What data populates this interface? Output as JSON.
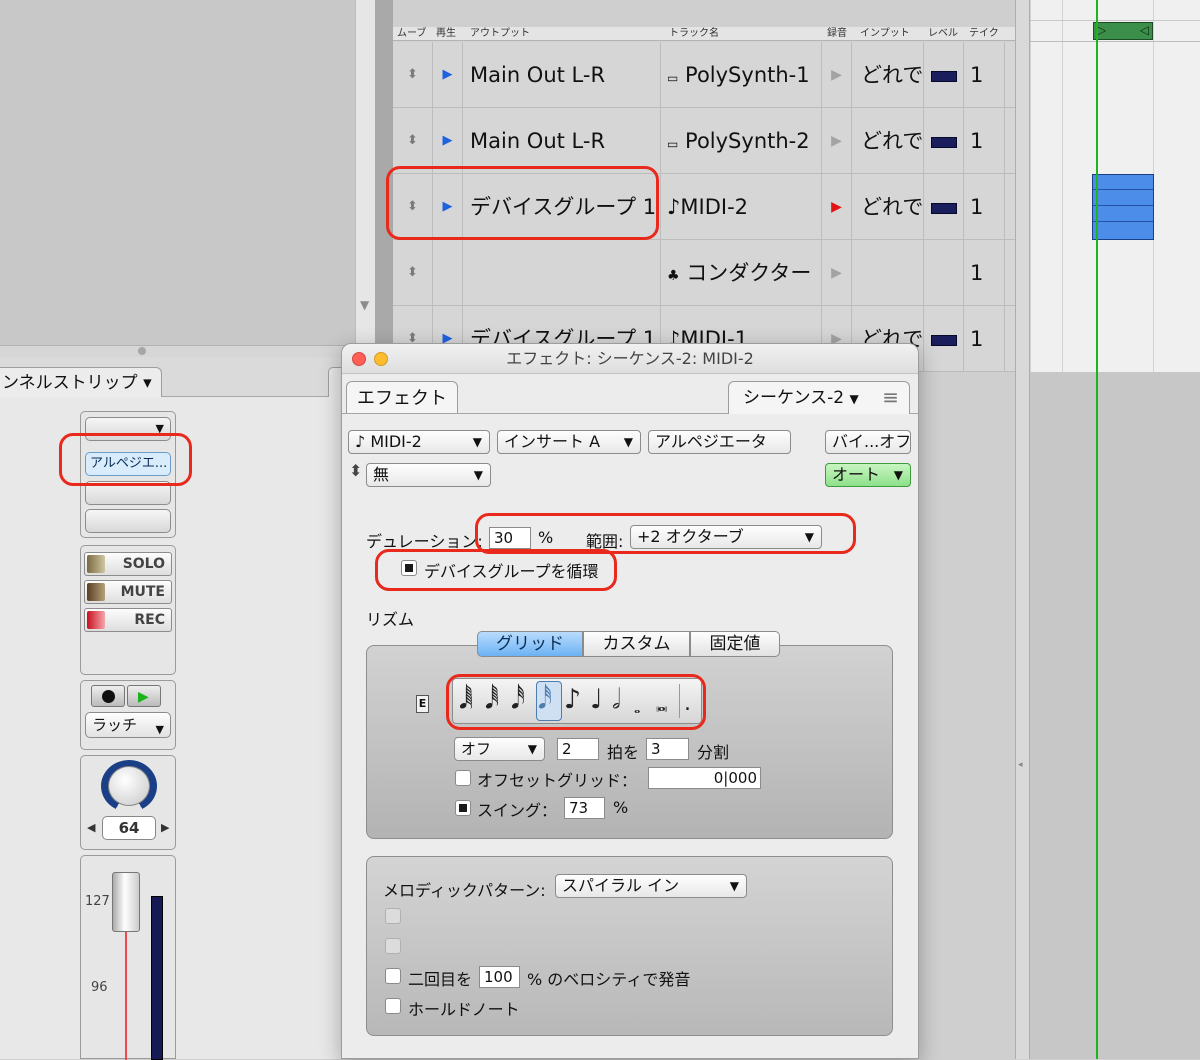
{
  "channel_strip": {
    "tab_label": "ンネルストリップ ▾",
    "insert_slot": "アルペジエ...",
    "solo": "SOLO",
    "mute": "MUTE",
    "rec": "REC",
    "latch": "ラッチ",
    "pan_value": "64",
    "fader_scale": [
      "127",
      "96"
    ]
  },
  "tracks": {
    "columns": [
      "ムーブ",
      "再生",
      "アウトプット",
      "トラック名",
      "録音",
      "インプット",
      "レベル",
      "テイク"
    ],
    "rows": [
      {
        "output": "Main Out L-R",
        "name": "PolySynth-1",
        "input": "どれで",
        "take": "1",
        "name_icon": "synth-icon"
      },
      {
        "output": "Main Out L-R",
        "name": "PolySynth-2",
        "input": "どれで",
        "take": "1",
        "name_icon": "synth-icon"
      },
      {
        "output": "デバイスグループ 1",
        "name": "MIDI-2",
        "input": "どれで",
        "take": "1",
        "name_icon": "note-icon"
      },
      {
        "output": "",
        "name": "コンダクター",
        "input": "",
        "take": "1",
        "name_icon": "conductor-icon"
      },
      {
        "output": "デバイスグループ 1",
        "name": "MIDI-1",
        "input": "どれで",
        "take": "1",
        "name_icon": "note-icon"
      }
    ]
  },
  "dialog": {
    "title": "エフェクト: シーケンス-2: MIDI-2",
    "tab": "エフェクト",
    "sequence_menu": "シーケンス-2",
    "track_select": "MIDI-2",
    "insert_select": "インサート A",
    "plugin_name": "アルペジエータ",
    "bypass": "バイ...オフ",
    "preset": "無",
    "auto": "オート",
    "duration_label": "デュレーション:",
    "duration_value": "30",
    "duration_unit": "%",
    "range_label": "範囲:",
    "range_value": "+2 オクターブ",
    "cycle_devices": "デバイスグループを循環",
    "rhythm_label": "リズム",
    "rhythm_tabs": [
      "グリッド",
      "カスタム",
      "固定値"
    ],
    "e_label": "E",
    "tuplet": "オフ",
    "beats": "2",
    "beats_label": "拍を",
    "divide": "3",
    "divide_label": "分割",
    "offset_label": "オフセットグリッド：",
    "offset_value": "0|000",
    "swing_label": "スイング：",
    "swing_value": "73",
    "swing_unit": "%",
    "melodic_label": "メロディックパターン:",
    "melodic_value": "スパイラル イン",
    "second_label_a": "二回目を",
    "second_value": "100",
    "second_label_b": "% のベロシティで発音",
    "hold_label": "ホールドノート"
  }
}
